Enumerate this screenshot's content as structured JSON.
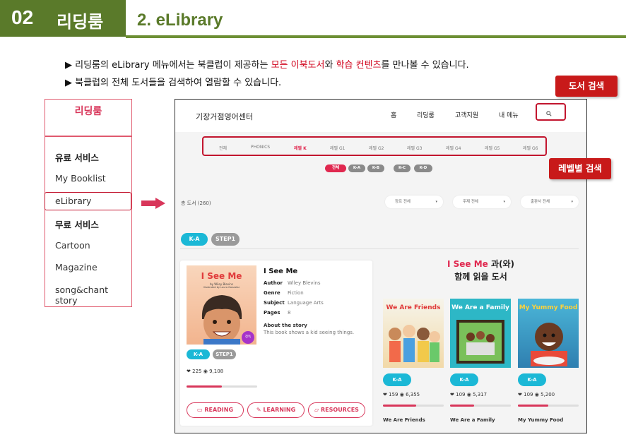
{
  "header": {
    "number": "02",
    "title": "리딩룸",
    "subtitle": "2. eLibrary"
  },
  "bullets": [
    {
      "pre": "▶ 리딩룸의 eLibrary 메뉴에서는 북클럽이 제공하는 ",
      "hl1": "모든 이북도서",
      "mid": "와 ",
      "hl2": "학습 컨텐츠",
      "post": "를  만나볼  수 있습니다."
    },
    {
      "text": "▶ 북클럽의 전체 도서들을 검색하여 열람할 수 있습니다."
    }
  ],
  "left_menu": {
    "title": "리딩룸",
    "items": [
      "유료 서비스",
      "My Booklist",
      "eLibrary",
      "무료 서비스",
      "Cartoon",
      "Magazine",
      "song&chant story"
    ],
    "selected": "eLibrary"
  },
  "site": {
    "name": "기장거점영어센터",
    "nav": [
      "홈",
      "리딩룸",
      "고객지원",
      "내 메뉴"
    ],
    "levels": [
      "전체",
      "PHONICS",
      "레벨 K",
      "레벨 G1",
      "레벨 G2",
      "레벨 G3",
      "레벨 G4",
      "레벨 G5",
      "레벨 G6"
    ],
    "level_active": "레벨 K",
    "sublevels": [
      "전체",
      "K-A",
      "K-B",
      "K-C",
      "K-D"
    ],
    "total": "총 도서 (260)",
    "filters": [
      "장르 전체",
      "주제 전체",
      "출판사 전체"
    ],
    "tags": [
      "K-A",
      "STEP1"
    ]
  },
  "book": {
    "cover_title": "I See Me",
    "cover_by": "by Wiley Blevins",
    "cover_ill": "Illustrated by Laura Gonzalez",
    "badge": "정독",
    "title": "I See Me",
    "author_label": "Author",
    "author": "Wiley Blevins",
    "genre_label": "Genre",
    "genre": "Fiction",
    "subject_label": "Subject",
    "subject": "Language Arts",
    "pages_label": "Pages",
    "pages": "8",
    "about_label": "About the story",
    "about": "This book shows a kid seeing things.",
    "tags": [
      "K-A",
      "STEP1"
    ],
    "likes": "225",
    "views": "9,108",
    "progress": 0.5,
    "buttons": [
      "READING",
      "LEARNING",
      "RESOURCES"
    ]
  },
  "together": {
    "title_hl": "I See Me",
    "title_rest": " 과(와)",
    "line2": "함께 읽을 도서"
  },
  "related": [
    {
      "cover": "We Are Friends",
      "name": "We Are Friends",
      "tag": "K-A",
      "likes": "159",
      "views": "6,355",
      "progress": 0.55
    },
    {
      "cover": "We Are a Family",
      "name": "We Are a Family",
      "tag": "K-A",
      "likes": "109",
      "views": "5,317",
      "progress": 0.4
    },
    {
      "cover": "My Yummy Food",
      "name": "My Yummy Food",
      "tag": "K-A",
      "likes": "109",
      "views": "5,200",
      "progress": 0.5
    }
  ],
  "callouts": {
    "search": "도서 검색",
    "level": "레벨별 검색"
  },
  "colors": {
    "header_green": "#5a7a2a",
    "accent_red": "#d8365a",
    "teal": "#1bb8d6",
    "callout_red": "#c81a1a"
  }
}
